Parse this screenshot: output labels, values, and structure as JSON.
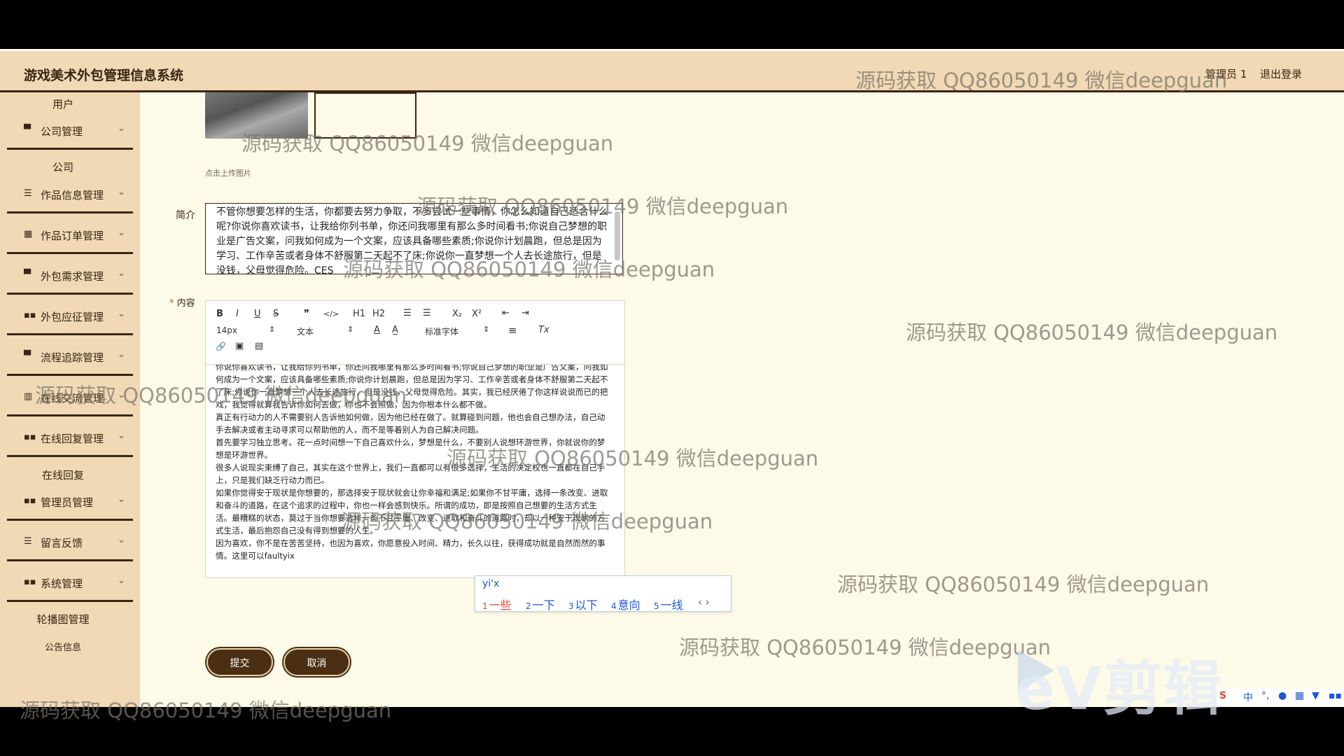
{
  "header": {
    "title": "游戏美术外包管理信息系统",
    "admin": "管理员 1",
    "logout": "退出登录"
  },
  "sidebar": {
    "user_sub": "用户",
    "company": "公司管理",
    "company_sub": "公司",
    "works": "作品信息管理",
    "orders": "作品订单管理",
    "demand": "外包需求管理",
    "apply": "外包应征管理",
    "track": "流程追踪管理",
    "chat": "在线交流管理",
    "reply": "在线回复管理",
    "reply_sub": "在线回复",
    "admin": "管理员管理",
    "feedback": "留言反馈",
    "system": "系统管理",
    "banner_sub": "轮播图管理",
    "notice_sub": "公告信息"
  },
  "form": {
    "upload_hint": "点击上传图片",
    "intro_label": "简介",
    "intro_text": "不管你想要怎样的生活，你都要去努力争取，不多尝试一些事情，你怎么知道自己适合什么呢?你说你喜欢读书，让我给你列书单，你还问我哪里有那么多时间看书;你说自己梦想的职业是广告文案，问我如何成为一个文案，应该具备哪些素质;你说你计划晨跑，但总是因为学习、工作辛苦或者身体不舒服第二天起不了床;你说你一直梦想一个人去长途旅行，但是没钱，父母觉得危险。CES",
    "content_label": "内容",
    "content_required": "*",
    "content_text": "你说你喜欢读书，让我给你列书单，你还问我哪里有那么多时间看书;你说自己梦想的职业是广告文案，问我如何成为一个文案，应该具备哪些素质;你说你计划晨跑，但总是因为学习、工作辛苦或者身体不舒服第二天起不了床;你说你一直梦想一个人去长途旅行，但是没钱，父母觉得危险。其实，我已经厌倦了你这样说说而已的把戏，我觉得就算我告诉你如何去做，你也不会照做，因为你根本什么都不做。\n真正有行动力的人不需要别人告诉他如何做，因为他已经在做了。就算碰到问题，他也会自己想办法，自己动手去解决或者主动寻求可以帮助他的人，而不是等着别人为自己解决问题。\n首先要学习独立思考。花一点时间想一下自己喜欢什么，梦想是什么，不要别人说想环游世界，你就说你的梦想是环游世界。\n很多人说现实束缚了自己，其实在这个世界上，我们一直都可以有很多选择，生活的决定权也一直都在自己手上，只是我们缺乏行动力而已。\n如果你觉得安于现状是你想要的，那选择安于现状就会让你幸福和满足;如果你不甘平庸，选择一条改变、进取和奋斗的道路，在这个追求的过程中，你也一样会感到快乐。所谓的成功，即是按照自己想要的生活方式生活。最糟糕的状态，莫过于当你想要选择一条不甘平庸、改变、进取和奋斗的道路时，却以一种安于现状的方式生活，最后抱怨自己没有得到想要的人生。\n因为喜欢，你不是在苦苦坚持，也因为喜欢，你愿意投入时间、精力，长久以往，获得成功就是自然而然的事情。这里可以faultyix",
    "submit": "提交",
    "cancel": "取消"
  },
  "editor_toolbar": {
    "bold": "B",
    "italic": "I",
    "underline": "U",
    "strike": "S",
    "quote": "❞",
    "code": "</>",
    "h1": "H1",
    "h2": "H2",
    "ol": "☰",
    "ul": "☰",
    "sub": "X₂",
    "sup": "X²",
    "outdent": "⇤",
    "indent": "⇥",
    "size": "14px",
    "format": "文本",
    "font": "标准字体",
    "color": "A",
    "bg": "A̲",
    "align": "≡",
    "clear": "Tx",
    "link": "🔗",
    "image": "▣",
    "video": "▤"
  },
  "ime": {
    "input": "yi'x",
    "candidates": [
      {
        "n": "1",
        "w": "一些"
      },
      {
        "n": "2",
        "w": "一下"
      },
      {
        "n": "3",
        "w": "以下"
      },
      {
        "n": "4",
        "w": "意向"
      },
      {
        "n": "5",
        "w": "一线"
      }
    ],
    "arrows": "‹ ›"
  },
  "watermark": "源码获取 QQ86050149 微信deepguan",
  "overlay": {
    "ev_logo": "eV剪辑"
  },
  "taskbar": {
    "ime_lang": "中"
  }
}
